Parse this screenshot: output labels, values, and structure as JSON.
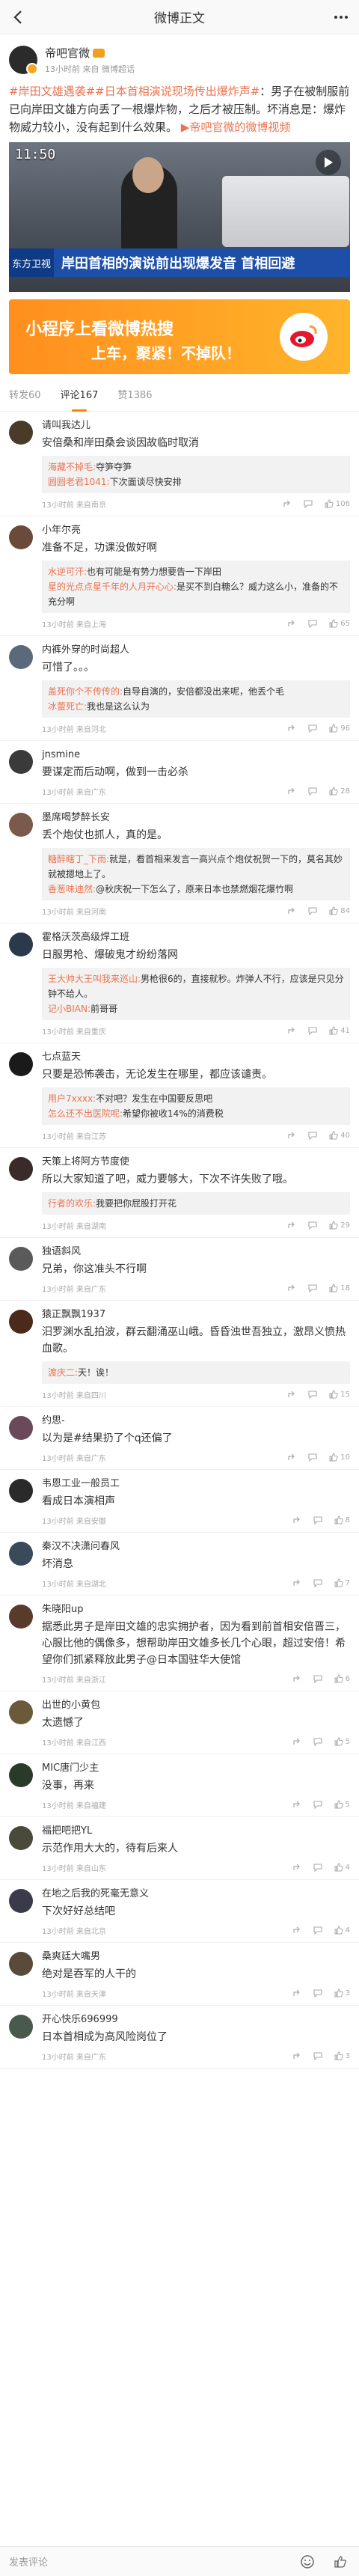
{
  "nav": {
    "title": "微博正文"
  },
  "post": {
    "author": "帝吧官微",
    "meta": "13小时前 来自 微博超话",
    "text_parts": [
      {
        "type": "topic",
        "text": "#岸田文雄遇袭#"
      },
      {
        "type": "topic",
        "text": "#日本首相演说现场传出爆炸声#"
      },
      {
        "type": "text",
        "text": "：男子在被制服前已向岸田文雄方向丢了一根爆炸物，之后才被压制。坏消息是：爆炸物威力较小，没有起到什么效果。"
      },
      {
        "type": "link",
        "text": "帝吧官微的微博视频"
      }
    ],
    "video": {
      "time": "11:50",
      "badge": "东方卫视",
      "headline": "岸田首相的演说前出现爆发音 首相回避"
    },
    "banner": {
      "line1": "小程序上看微博热搜",
      "line2": "上车，聚紧！不掉队！"
    }
  },
  "tabs": [
    {
      "label": "转发60",
      "active": false
    },
    {
      "label": "评论167",
      "active": true
    },
    {
      "label": "赞1386",
      "active": false
    }
  ],
  "comments": [
    {
      "user": "请叫我达儿",
      "text": "安倍桑和岸田桑会谈因故临时取消",
      "replies": [
        {
          "name": "海藏不掉毛:",
          "text": "夺笋夺笋"
        },
        {
          "name": "圆圆老君1041:",
          "text": "下次面谈尽快安排"
        }
      ],
      "time": "13小时前 来自南京",
      "likes": "106",
      "color": "#4a3a2a"
    },
    {
      "user": "小年尔亮",
      "text": "准备不足，功课没做好啊",
      "replies": [
        {
          "name": "水逆可汗:",
          "text": "也有可能是有势力想要告一下岸田"
        },
        {
          "name": "星的光点点星千年的人月开心心:",
          "text": "是买不到白糖么？威力这么小，准备的不充分啊"
        }
      ],
      "time": "13小时前 来自上海",
      "likes": "65",
      "color": "#6a4a3a"
    },
    {
      "user": "内裤外穿的时尚超人",
      "text": "可惜了。。。",
      "replies": [
        {
          "name": "盖死你个不传传的:",
          "text": "自导自演的，安倍都没出来呢，他丢个毛"
        },
        {
          "name": "冰蕾死亡:",
          "text": "我也是这么认为"
        }
      ],
      "time": "13小时前 来自河北",
      "likes": "96",
      "color": "#5a6a7a"
    },
    {
      "user": "jnsmine",
      "text": "要谋定而后动啊，做到一击必杀",
      "replies": [],
      "time": "13小时前 来自广东",
      "likes": "28",
      "color": "#3a3a3a"
    },
    {
      "user": "墨席喝梦醉长安",
      "text": "丢个炮仗也抓人，真的是。",
      "replies": [
        {
          "name": "糖醉瞎丁_下雨:",
          "text": "就是，看首相来发言一高兴点个炮仗祝贺一下的，莫名其妙就被摁地上了。"
        },
        {
          "name": "香葱味迪然:",
          "text": "@秋庆祝一下怎么了，原来日本也禁燃烟花爆竹啊"
        }
      ],
      "time": "13小时前 来自河南",
      "likes": "84",
      "color": "#7a5a4a"
    },
    {
      "user": "霍格沃茨高级焊工班",
      "text": "日服男枪、爆破鬼才纷纷落网",
      "replies": [
        {
          "name": "王大帅大王叫我来巡山:",
          "text": "男枪很6的，直接就秒。炸弹人不行，应该是只见分钟不给人。"
        },
        {
          "name": "记小BIAN:",
          "text": "前哥哥"
        }
      ],
      "time": "13小时前 来自重庆",
      "likes": "41",
      "color": "#2a3a4a"
    },
    {
      "user": "七点蓝天",
      "text": "只要是恐怖袭击，无论发生在哪里，都应该谴责。",
      "replies": [
        {
          "name": "用户7xxxx:",
          "text": "不对吧？发生在中国要反思吧"
        },
        {
          "name": "怎么还不出医院呢:",
          "text": "希望你被收14%的消费税"
        }
      ],
      "time": "13小时前 来自江苏",
      "likes": "40",
      "color": "#1a1a1a"
    },
    {
      "user": "天策上将阿方节度使",
      "text": "所以大家知道了吧，威力要够大，下次不许失败了哦。",
      "replies": [
        {
          "name": "行者的欢乐:",
          "text": "我要把你屁股打开花"
        }
      ],
      "time": "13小时前 来自湖南",
      "likes": "29",
      "color": "#3a2a2a"
    },
    {
      "user": "独语斜风",
      "text": "兄弟，你这准头不行啊",
      "replies": [],
      "time": "13小时前 来自广东",
      "likes": "18",
      "color": "#5a5a5a"
    },
    {
      "user": "猿正飘飘1937",
      "text": "汨罗渊水乱拍波，群云翻涌巫山峨。昏昏浊世吾独立，激昂义愤热血歌。",
      "replies": [
        {
          "name": "渡庆二:",
          "text": "天！诶！"
        }
      ],
      "time": "13小时前 来自四川",
      "likes": "15",
      "color": "#4a2a1a"
    },
    {
      "user": "约思-",
      "text": "以为是#结果扔了个q还偏了",
      "replies": [],
      "time": "13小时前 来自广东",
      "likes": "10",
      "color": "#6a4a5a"
    },
    {
      "user": "韦恩工业一般员工",
      "text": "看成日本演相声",
      "replies": [],
      "time": "13小时前 来自安徽",
      "likes": "8",
      "color": "#2a2a2a"
    },
    {
      "user": "秦汉不决潇问春风",
      "text": "坏消息",
      "replies": [],
      "time": "13小时前 来自湖北",
      "likes": "7",
      "color": "#3a4a5a"
    },
    {
      "user": "朱晓阳up",
      "text": "据悉此男子是岸田文雄的忠实拥护者，因为看到前首相安倍晋三，心服比他的偶像多，想帮助岸田文雄多长几个心眼，超过安倍！希望你们抓紧释放此男子@日本国驻华大使馆",
      "replies": [],
      "time": "13小时前 来自浙江",
      "likes": "6",
      "color": "#5a3a2a"
    },
    {
      "user": "出世的小黄包",
      "text": "太遗憾了",
      "replies": [],
      "time": "13小时前 来自江西",
      "likes": "5",
      "color": "#6a5a3a"
    },
    {
      "user": "MIC唐门少主",
      "text": "没事，再来",
      "replies": [],
      "time": "13小时前 来自福建",
      "likes": "5",
      "color": "#2a3a2a"
    },
    {
      "user": "福把吧把YL",
      "text": "示范作用大大的，待有后来人",
      "replies": [],
      "time": "13小时前 来自山东",
      "likes": "4",
      "color": "#4a4a3a"
    },
    {
      "user": "在地之后我的死毫无意义",
      "text": "下次好好总结吧",
      "replies": [],
      "time": "13小时前 来自北京",
      "likes": "4",
      "color": "#3a3a4a"
    },
    {
      "user": "桑爽廷大嘴男",
      "text": "绝对是吞军的人干的",
      "replies": [],
      "time": "13小时前 来自天津",
      "likes": "3",
      "color": "#5a4a3a"
    },
    {
      "user": "开心快乐696999",
      "text": "日本首相成为高风险岗位了",
      "replies": [],
      "time": "13小时前 来自广东",
      "likes": "3",
      "color": "#4a5a4a"
    }
  ],
  "bottom": {
    "placeholder": "发表评论"
  }
}
